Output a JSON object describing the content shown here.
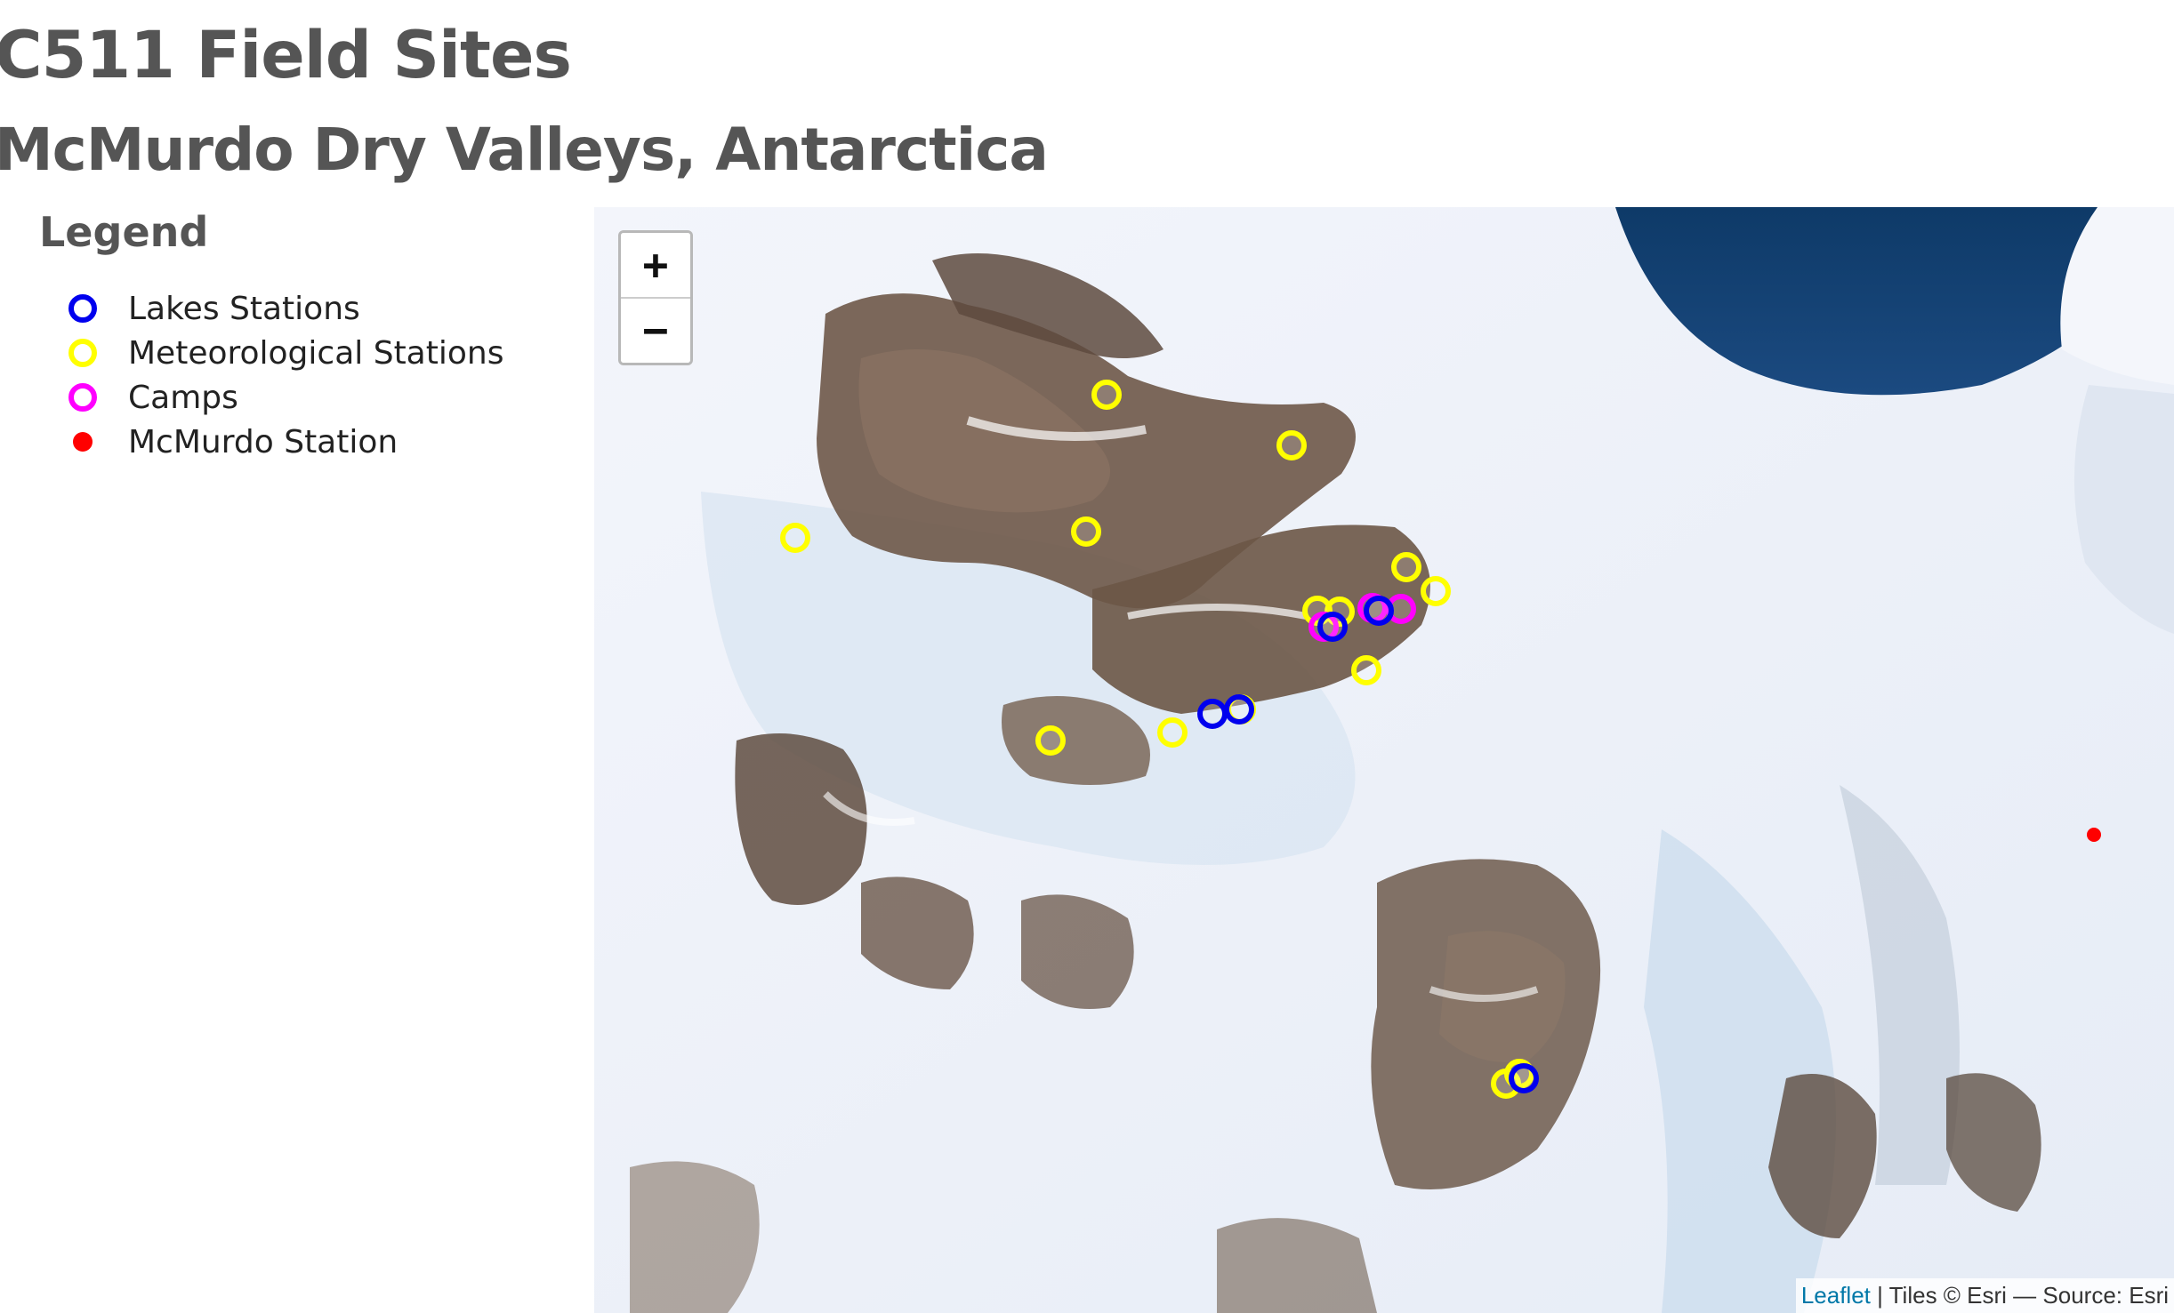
{
  "header": {
    "title": "C511 Field Sites",
    "subtitle": "McMurdo Dry Valleys, Antarctica"
  },
  "legend": {
    "heading": "Legend",
    "items": [
      {
        "label": "Lakes Stations",
        "color": "#0000ee",
        "shape": "ring"
      },
      {
        "label": "Meteorological Stations",
        "color": "#ffff00",
        "shape": "ring"
      },
      {
        "label": "Camps",
        "color": "#ff00ff",
        "shape": "ring"
      },
      {
        "label": "McMurdo Station",
        "color": "#ff0000",
        "shape": "dot"
      }
    ]
  },
  "map": {
    "zoom_in_label": "+",
    "zoom_out_label": "−",
    "attribution": {
      "link_text": "Leaflet",
      "text": " | Tiles © Esri — Source: Esri"
    }
  }
}
